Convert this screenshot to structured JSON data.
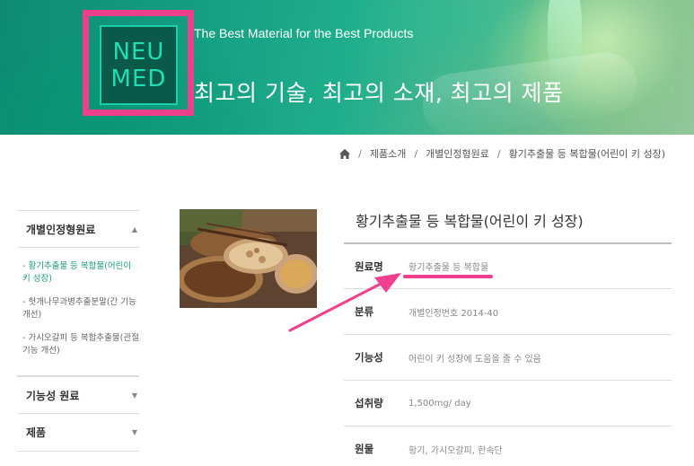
{
  "banner": {
    "logo_line1": "NEU",
    "logo_line2": "MED",
    "tagline": "The Best Material for the Best Products",
    "title": "최고의 기술, 최고의 소재, 최고의 제품"
  },
  "breadcrumb": [
    "제품소개",
    "개별인정형원료",
    "황기추출물 등 복합물(어린이 키 성장)"
  ],
  "sidebar": {
    "sections": [
      {
        "label": "개별인정형원료",
        "items": [
          "- 황기추출물 등 복합물(어린이 키 성장)",
          "- 헛개나무과병추출분말(간 기능 개선)",
          "- 가시오갈피 등 복합추출물(관절 기능 개선)"
        ]
      },
      {
        "label": "기능성 원료",
        "items": []
      },
      {
        "label": "제품",
        "items": []
      }
    ]
  },
  "product": {
    "title": "황기추출물 등 복합물(어린이 키 성장)",
    "rows": [
      {
        "label": "원료명",
        "value": "황기추출물 등 복합물"
      },
      {
        "label": "분류",
        "value": "개별인정번호 2014-40"
      },
      {
        "label": "기능성",
        "value": "어린이 키 성장에 도움을 줄 수 있음"
      },
      {
        "label": "섭취량",
        "value": "1,500mg/ day"
      },
      {
        "label": "원물",
        "value": "황기, 가시오갈피, 한속단"
      }
    ]
  },
  "colors": {
    "accent_pink": "#ec3f8c",
    "active_green": "#1e9a7a",
    "logo_teal": "#1fe0b5"
  },
  "icons": {
    "home": "home-icon",
    "collapse": "caret-up-icon",
    "expand": "caret-down-icon"
  }
}
